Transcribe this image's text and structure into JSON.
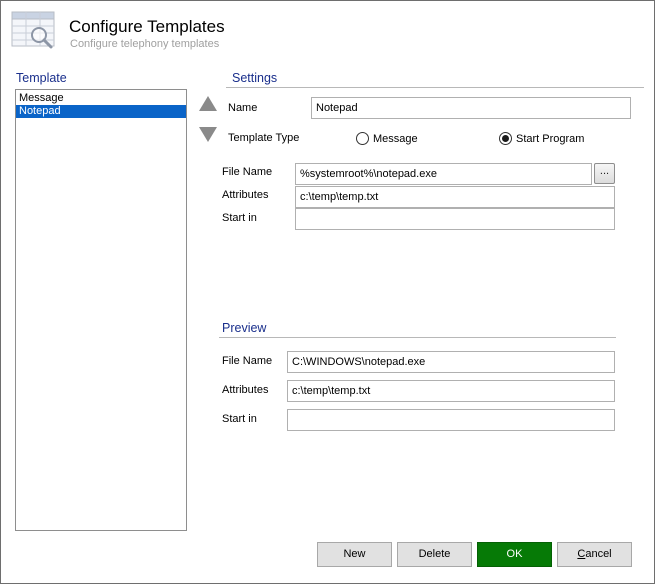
{
  "header": {
    "title": "Configure Templates",
    "subtitle": "Configure telephony templates",
    "icon": "table-search-icon"
  },
  "template_panel": {
    "title": "Template",
    "items": [
      {
        "label": "Message",
        "selected": false
      },
      {
        "label": "Notepad",
        "selected": true
      }
    ]
  },
  "settings": {
    "title": "Settings",
    "name_label": "Name",
    "name_value": "Notepad",
    "type_label": "Template Type",
    "type_options": [
      {
        "label": "Message",
        "checked": false
      },
      {
        "label": "Start Program",
        "checked": true
      }
    ],
    "file_name_label": "File Name",
    "file_name_value": "%systemroot%\\notepad.exe",
    "browse_label": "...",
    "attributes_label": "Attributes",
    "attributes_value": "c:\\temp\\temp.txt",
    "start_in_label": "Start in",
    "start_in_value": ""
  },
  "preview": {
    "title": "Preview",
    "file_name_label": "File Name",
    "file_name_value": "C:\\WINDOWS\\notepad.exe",
    "attributes_label": "Attributes",
    "attributes_value": "c:\\temp\\temp.txt",
    "start_in_label": "Start in",
    "start_in_value": ""
  },
  "buttons": {
    "new": "New",
    "delete": "Delete",
    "ok": "OK",
    "cancel_prefix": "C",
    "cancel_rest": "ancel"
  },
  "colors": {
    "accent_title": "#1a2f8c",
    "selection": "#0a64c8",
    "ok_button": "#067a06"
  }
}
